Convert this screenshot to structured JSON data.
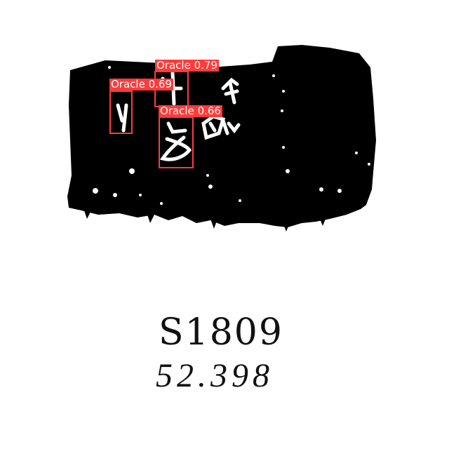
{
  "image": {
    "subject": "oracle bone rubbing",
    "colors": {
      "ink": "#000000",
      "paper": "#ffffff",
      "box": "#ff3b3b",
      "label_text": "#ffffff"
    }
  },
  "detections": [
    {
      "label": "Oracle 0.79"
    },
    {
      "label": "Oracle 0.69"
    },
    {
      "label": "Oracle 0.66"
    }
  ],
  "catalog": {
    "id": "S1809",
    "number": "52.398"
  }
}
